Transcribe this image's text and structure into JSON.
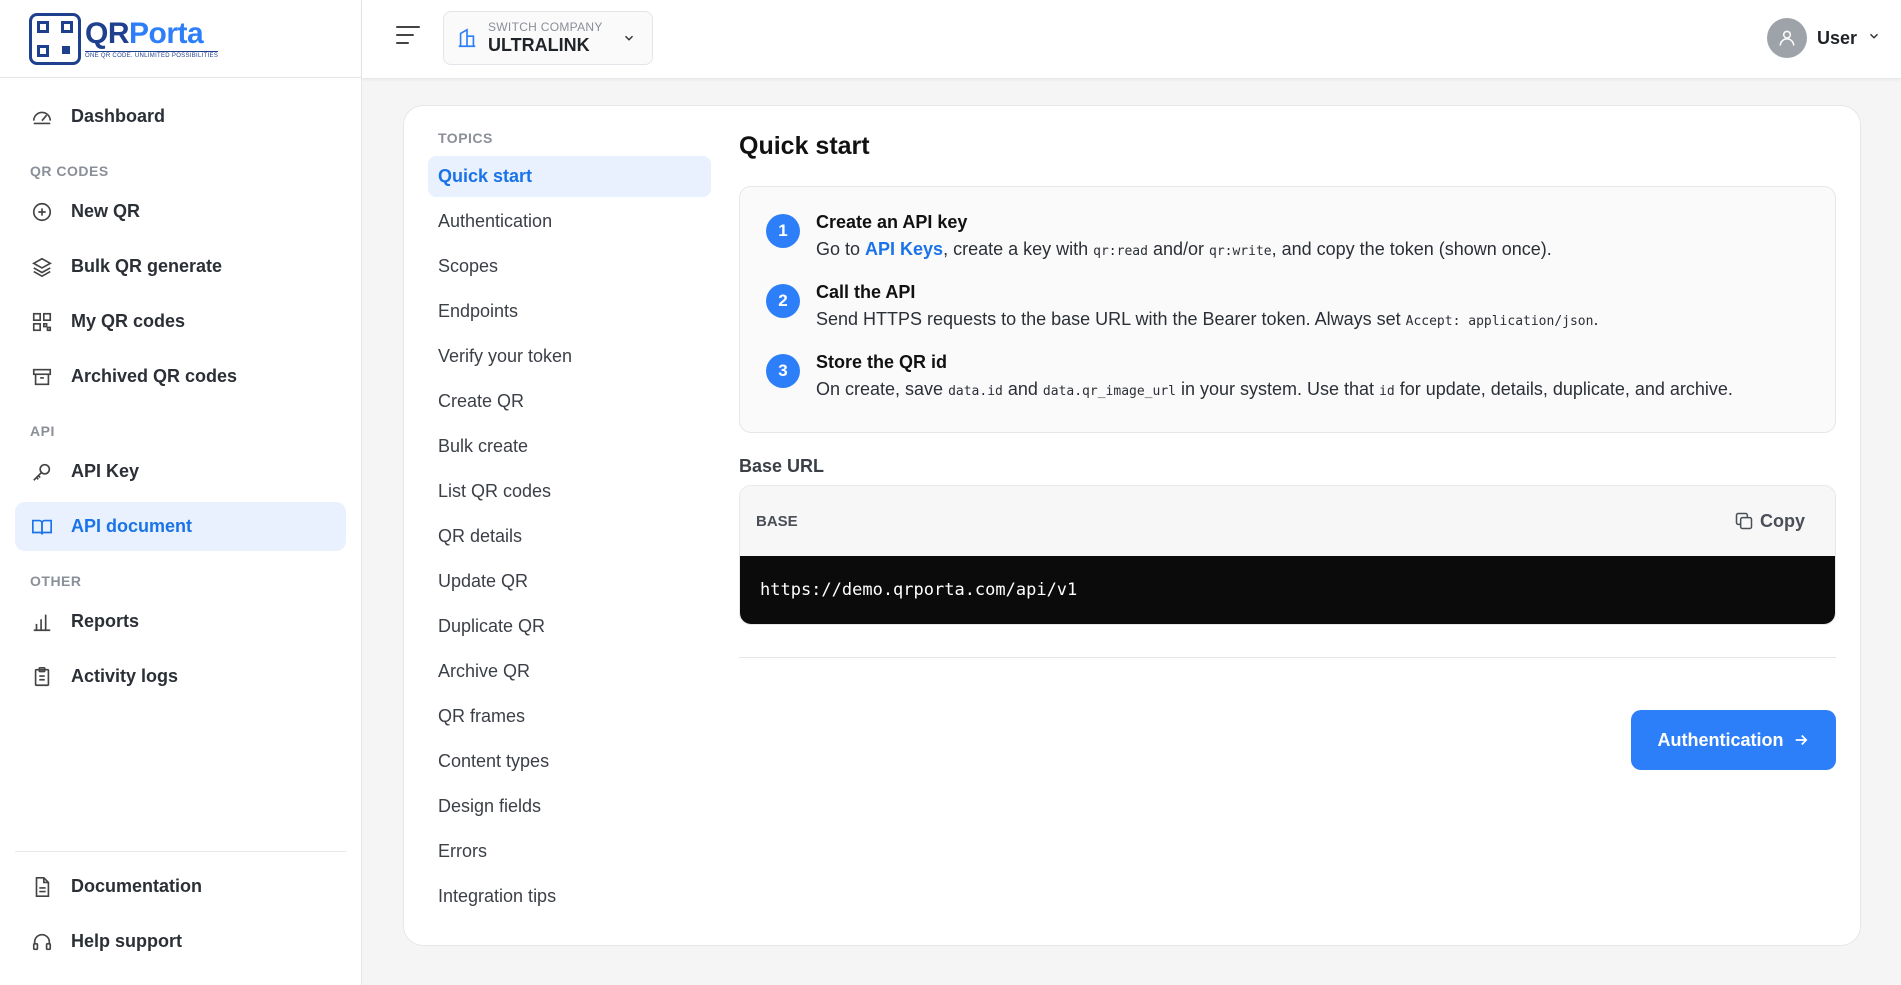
{
  "brand": {
    "name_a": "QR",
    "name_b": "Porta",
    "tagline": "ONE QR CODE. UNLIMITED POSSIBILITIES"
  },
  "sidebar": {
    "dashboard": "Dashboard",
    "section_qr": "QR CODES",
    "new_qr": "New QR",
    "bulk_qr": "Bulk QR generate",
    "my_qr": "My QR codes",
    "archived_qr": "Archived QR codes",
    "section_api": "API",
    "api_key": "API Key",
    "api_doc": "API document",
    "section_other": "OTHER",
    "reports": "Reports",
    "activity": "Activity logs",
    "documentation": "Documentation",
    "help": "Help support"
  },
  "header": {
    "company_label": "SWITCH COMPANY",
    "company_name": "ULTRALINK",
    "user_name": "User"
  },
  "topics": {
    "heading": "TOPICS",
    "items": [
      "Quick start",
      "Authentication",
      "Scopes",
      "Endpoints",
      "Verify your token",
      "Create QR",
      "Bulk create",
      "List QR codes",
      "QR details",
      "Update QR",
      "Duplicate QR",
      "Archive QR",
      "QR frames",
      "Content types",
      "Design fields",
      "Errors",
      "Integration tips"
    ]
  },
  "content": {
    "title": "Quick start",
    "steps": [
      {
        "num": "1",
        "title": "Create an API key",
        "d1": "Go to ",
        "link": "API Keys",
        "d2": ", create a key with ",
        "c1": "qr:read",
        "d3": " and/or ",
        "c2": "qr:write",
        "d4": ", and copy the token (shown once)."
      },
      {
        "num": "2",
        "title": "Call the API",
        "d1": "Send HTTPS requests to the base URL with the Bearer token. Always set ",
        "c1": "Accept: application/json",
        "d2": "."
      },
      {
        "num": "3",
        "title": "Store the QR id",
        "d1": "On create, save ",
        "c1": "data.id",
        "d2": " and ",
        "c2": "data.qr_image_url",
        "d3": " in your system. Use that ",
        "c3": "id",
        "d4": " for update, details, duplicate, and archive."
      }
    ],
    "base_label": "Base URL",
    "base_tag": "BASE",
    "copy_label": "Copy",
    "base_url": "https://demo.qrporta.com/api/v1",
    "next_label": "Authentication"
  },
  "colors": {
    "accent": "#2d7ff9",
    "active_bg": "#e8f1fd",
    "active_text": "#1a73e8",
    "code_bg": "#0b0b0b"
  }
}
